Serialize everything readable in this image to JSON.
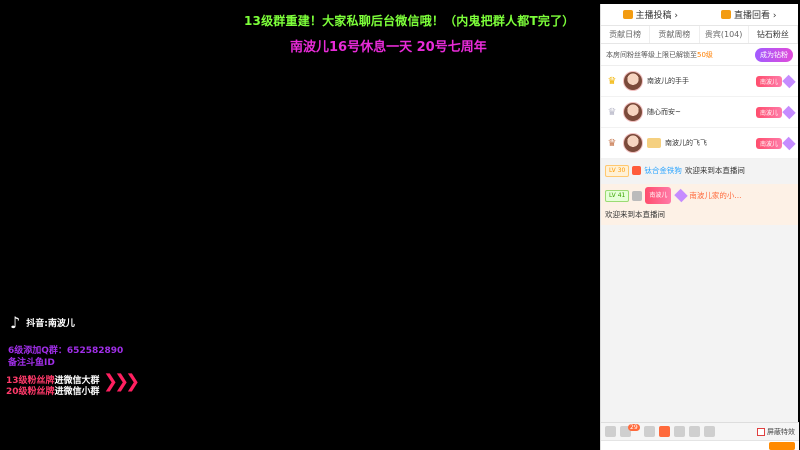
{
  "overlay": {
    "line1": "13级群重建！大家私聊后台微信哦！（内鬼把群人都T完了）",
    "line2": "南波儿16号休息一天 20号七周年",
    "tiktok_icon": "♪",
    "tiktok_label": "抖音:南波儿",
    "info1": "6级添加Q群：652582890",
    "info2": "备注斗鱼ID",
    "fans1_red": "13级粉丝牌",
    "fans1_white": "进微信大群",
    "fans2_red": "20级粉丝牌",
    "fans2_white": "进微信小群",
    "arrows": "❯❯❯"
  },
  "panel": {
    "top_left": "主播投稿 ›",
    "top_right": "直播回看 ›",
    "tabs": [
      "贡献日榜",
      "贡献周榜",
      "贵宾(104)",
      "钻石粉丝"
    ],
    "notice_prefix": "本房间粉丝等级上限已解锁至",
    "notice_level": "50级",
    "join_label": "成为钻粉",
    "fans": [
      {
        "crown": "♛",
        "name": "南波儿的手手",
        "badge": "南波儿"
      },
      {
        "crown": "♛",
        "name": "随心而安~",
        "badge": "南波儿"
      },
      {
        "crown": "♛",
        "name": "南波儿的飞飞",
        "badge": "南波儿"
      }
    ],
    "chat": [
      {
        "level": "LV 30",
        "name": "钛合金铁狗",
        "text": "欢迎来到本直播间"
      },
      {
        "level": "LV 41",
        "badge": "南波儿",
        "name": "南波儿家的小...",
        "text": "欢迎来到本直播间"
      }
    ],
    "shield_label": "屏蔽特效",
    "notify_count": "29"
  },
  "colors": {
    "accent": "#ff8a00",
    "overlay_green": "#7dff3a",
    "overlay_pink": "#e82bd8"
  }
}
